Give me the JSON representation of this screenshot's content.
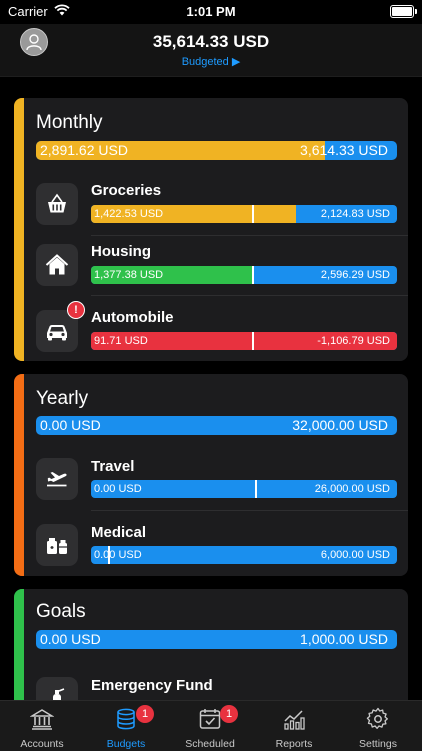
{
  "status_bar": {
    "carrier": "Carrier",
    "time": "1:01 PM"
  },
  "header": {
    "total": "35,614.33 USD",
    "subtitle": "Budgeted ▶"
  },
  "colors": {
    "yellow": "#f0b323",
    "orange": "#f36d15",
    "green": "#2fc14b",
    "red": "#e8323f",
    "blue": "#1a8fee"
  },
  "monthly": {
    "title": "Monthly",
    "spent": "2,891.62 USD",
    "budget": "3,614.33 USD",
    "progress": 0.8,
    "categories": [
      {
        "name": "Groceries",
        "icon": "basket-icon",
        "spent": "1,422.53 USD",
        "remaining": "2,124.83 USD",
        "progress": 0.67,
        "period_mark": 0.53
      },
      {
        "name": "Housing",
        "icon": "house-icon",
        "spent": "1,377.38 USD",
        "remaining": "2,596.29 USD",
        "progress": 0.53,
        "period_mark": 0.53
      },
      {
        "name": "Automobile",
        "icon": "car-icon",
        "spent": "91.71 USD",
        "remaining": "-1,106.79 USD",
        "progress": 1.0,
        "period_mark": 0.53,
        "alert": "!"
      }
    ]
  },
  "yearly": {
    "title": "Yearly",
    "spent": "0.00 USD",
    "budget": "32,000.00 USD",
    "progress": 0,
    "categories": [
      {
        "name": "Travel",
        "icon": "airplane-icon",
        "spent": "0.00 USD",
        "remaining": "26,000.00 USD",
        "progress": 0,
        "period_mark": 0.54
      },
      {
        "name": "Medical",
        "icon": "medicine-icon",
        "spent": "0.00 USD",
        "remaining": "6,000.00 USD",
        "progress": 0,
        "period_mark": 0.06
      }
    ]
  },
  "goals": {
    "title": "Goals",
    "spent": "0.00 USD",
    "budget": "1,000.00 USD",
    "progress": 0,
    "categories": [
      {
        "name": "Emergency Fund",
        "icon": "extinguisher-icon"
      }
    ]
  },
  "tabs": [
    {
      "label": "Accounts",
      "icon": "bank-icon"
    },
    {
      "label": "Budgets",
      "icon": "coins-icon",
      "badge": "1",
      "active": true
    },
    {
      "label": "Scheduled",
      "icon": "calendar-icon",
      "badge": "1"
    },
    {
      "label": "Reports",
      "icon": "chart-icon"
    },
    {
      "label": "Settings",
      "icon": "gear-icon"
    }
  ]
}
